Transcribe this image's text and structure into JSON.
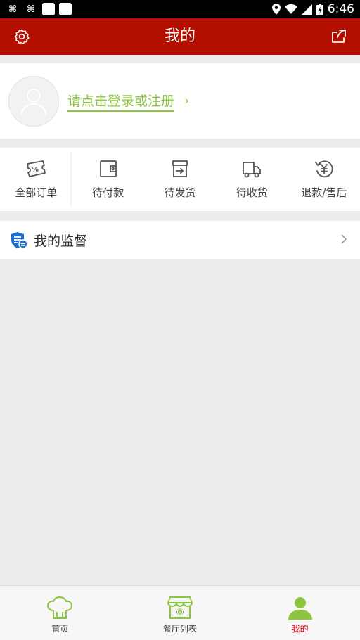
{
  "status_bar": {
    "time": "6:46",
    "left_icons": [
      "app-icon",
      "app-icon",
      "notification-square",
      "notification-square"
    ],
    "right_icons": [
      "location-icon",
      "wifi-icon",
      "signal-icon",
      "battery-icon"
    ]
  },
  "header": {
    "title": "我的",
    "left_icon": "settings-icon",
    "right_icon": "share-icon",
    "color": "#b30e00"
  },
  "login": {
    "link_text": "请点击登录或注册",
    "chevron": "›",
    "accent": "#8cc63e"
  },
  "orders": {
    "items": [
      {
        "label": "全部订单",
        "icon": "percent-ticket-icon"
      },
      {
        "label": "待付款",
        "icon": "wallet-icon"
      },
      {
        "label": "待发货",
        "icon": "box-icon"
      },
      {
        "label": "待收货",
        "icon": "truck-icon"
      },
      {
        "label": "退款/售后",
        "icon": "refund-yen-icon"
      }
    ]
  },
  "supervision": {
    "label": "我的监督",
    "icon": "shield-list-icon"
  },
  "bottom_nav": {
    "items": [
      {
        "label": "首页",
        "icon": "chef-hat-icon",
        "active": false
      },
      {
        "label": "餐厅列表",
        "icon": "restaurant-icon",
        "active": false
      },
      {
        "label": "我的",
        "icon": "user-icon",
        "active": true
      }
    ],
    "active_color": "#e60012",
    "icon_color": "#8cc63e"
  }
}
